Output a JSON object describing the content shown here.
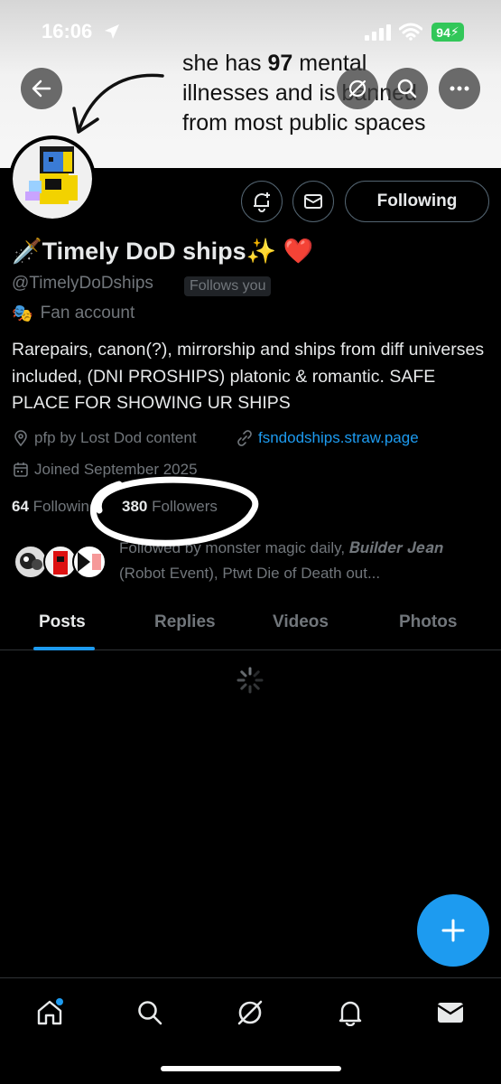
{
  "status_bar": {
    "time": "16:06",
    "battery": "94"
  },
  "banner": {
    "line1_pre": "she has ",
    "line1_num": "97",
    "line1_post": " mental",
    "line2": "illnesses and is banned",
    "line3": "from most public spaces"
  },
  "profile": {
    "display_name": "🗡️Timely DoD ships✨ ❤️",
    "handle": "@TimelyDoDships",
    "follows_you": "Follows you",
    "category": "Fan account",
    "bio": "Rarepairs, canon(?), mirrorship and ships from diff universes included, (DNI PROSHIPS) platonic & romantic. SAFE PLACE FOR SHOWING UR SHIPS",
    "pfp_credit": "pfp by Lost Dod content",
    "link": "fsndodships.straw.page",
    "joined": "Joined September 2025",
    "following_count": "64",
    "following_label": "Following",
    "followers_count": "380",
    "followers_label": "Followers",
    "followed_by": "Followed by monster magic daily, 𝑩𝒖𝒊𝒍𝒅𝒆𝒓 𝑱𝒆𝒂𝒏 (Robot Event), Ptwt Die of Death out..."
  },
  "actions": {
    "following_button": "Following"
  },
  "tabs": [
    {
      "label": "Posts",
      "active": true
    },
    {
      "label": "Replies",
      "active": false
    },
    {
      "label": "Videos",
      "active": false
    },
    {
      "label": "Photos",
      "active": false
    }
  ],
  "colors": {
    "accent": "#1d9bf0",
    "muted": "#71767b",
    "battery": "#32c759"
  },
  "icons": {
    "nav": [
      "home-icon",
      "search-icon",
      "grok-icon",
      "bell-icon",
      "mail-icon"
    ],
    "header": [
      "back-arrow-icon",
      "grok-icon",
      "search-icon",
      "more-icon"
    ]
  }
}
